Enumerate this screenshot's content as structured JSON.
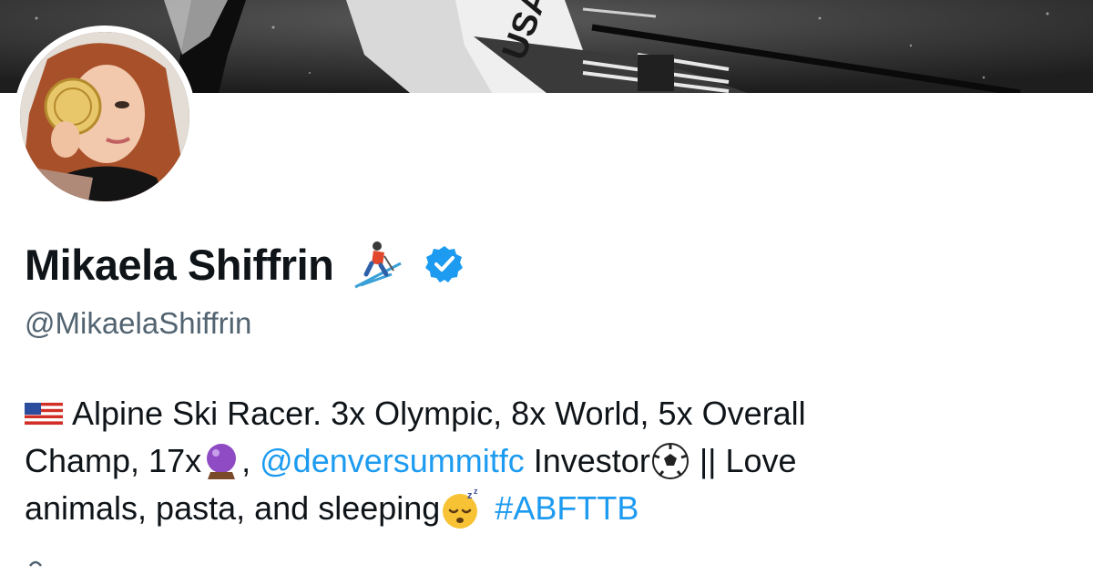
{
  "profile": {
    "display_name": "Mikaela Shiffrin",
    "handle": "@MikaelaShiffrin",
    "banner_text": "USA",
    "verified": true
  },
  "bio": {
    "line1_text": "Alpine Ski Racer. 3x Olympic, 8x World, 5x Overall",
    "line2_prefix": "Champ, 17x",
    "line2_comma": ",",
    "mention": "@denversummitfc",
    "line2_investor": "Investor",
    "line2_suffix": "|| Love",
    "line3_text": "animals, pasta, and sleeping",
    "hashtag": "#ABFTTB"
  },
  "icons": {
    "flag": "us-flag-icon",
    "skier": "skier-icon",
    "verified": "verified-badge-icon",
    "crystal_ball": "crystal-ball-icon",
    "soccer_ball": "soccer-ball-icon",
    "sleeping_face": "sleeping-face-icon"
  },
  "colors": {
    "link": "#1d9bf0",
    "verified": "#1d9bf0",
    "handle": "#536471",
    "text": "#0f1419"
  }
}
